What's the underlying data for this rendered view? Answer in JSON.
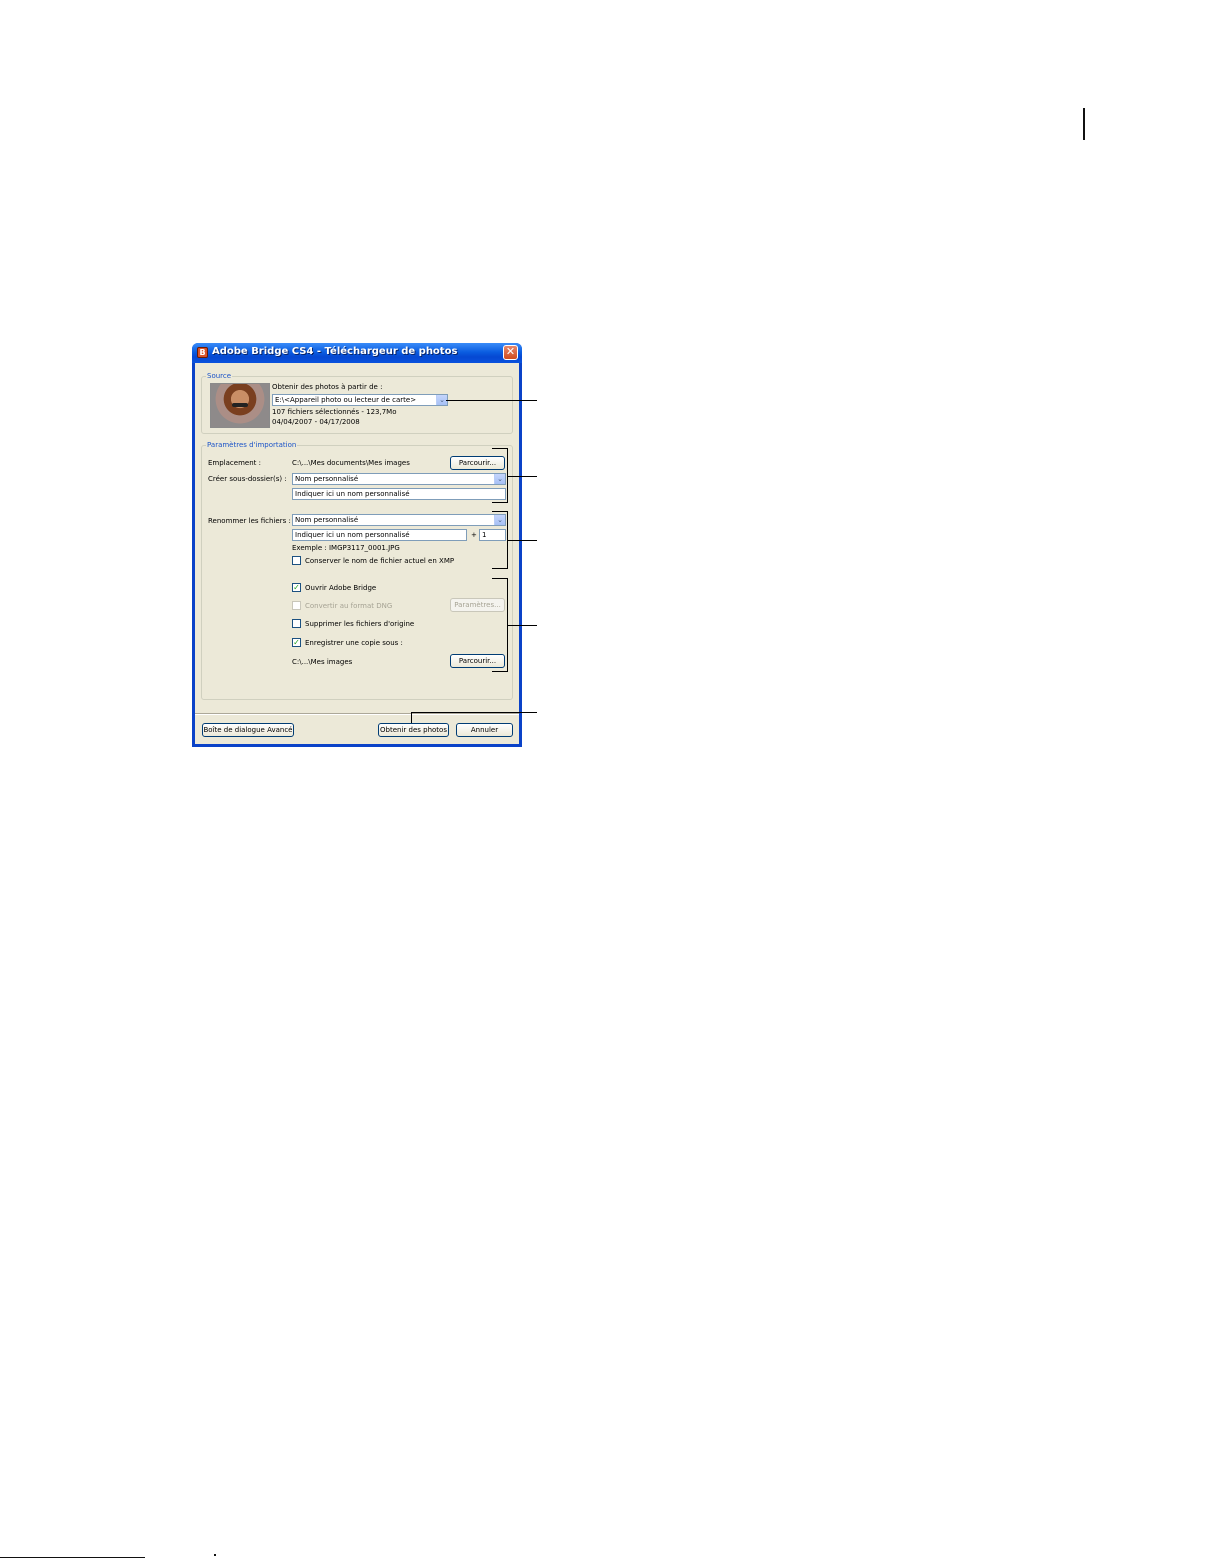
{
  "window": {
    "title": "Adobe Bridge CS4 - Téléchargeur de photos",
    "close_glyph": "✕",
    "app_icon": "adobe-bridge-icon"
  },
  "source": {
    "legend": "Source",
    "get_from_label": "Obtenir des photos à partir de :",
    "device_value": "E:\\<Appareil photo ou lecteur de carte>",
    "files_info": "107 fichiers sélectionnés - 123,7Mo",
    "date_range": "04/04/2007 - 04/17/2008"
  },
  "import": {
    "legend": "Paramètres d'importation",
    "location_label": "Emplacement :",
    "location_path": "C:\\...\\Mes documents\\Mes images",
    "browse_label": "Parcourir...",
    "subfolder_label": "Créer sous-dossier(s) :",
    "subfolder_value": "Nom personnalisé",
    "subfolder_name": "Indiquer ici un nom personnalisé",
    "rename_label": "Renommer les fichiers :",
    "rename_value": "Nom personnalisé",
    "rename_name": "Indiquer ici un nom personnalisé",
    "plus": "+",
    "sequence_start": "1",
    "example": "Exemple : IMGP3117_0001.JPG",
    "keep_xmp_label": "Conserver le nom de fichier actuel en XMP",
    "keep_xmp_checked": false,
    "open_bridge_label": "Ouvrir Adobe Bridge",
    "open_bridge_checked": true,
    "convert_dng_label": "Convertir au format DNG",
    "convert_dng_checked": false,
    "settings_label": "Paramètres...",
    "delete_originals_label": "Supprimer les fichiers d'origine",
    "delete_originals_checked": false,
    "save_copy_label": "Enregistrer une copie sous :",
    "save_copy_checked": true,
    "copy_path": "C:\\...\\Mes images",
    "browse2_label": "Parcourir..."
  },
  "footer": {
    "advanced_label": "Boîte de dialogue Avancé",
    "get_photos_label": "Obtenir des photos",
    "cancel_label": "Annuler"
  },
  "checkmark": "✓",
  "dropdown_glyph": "⌄"
}
